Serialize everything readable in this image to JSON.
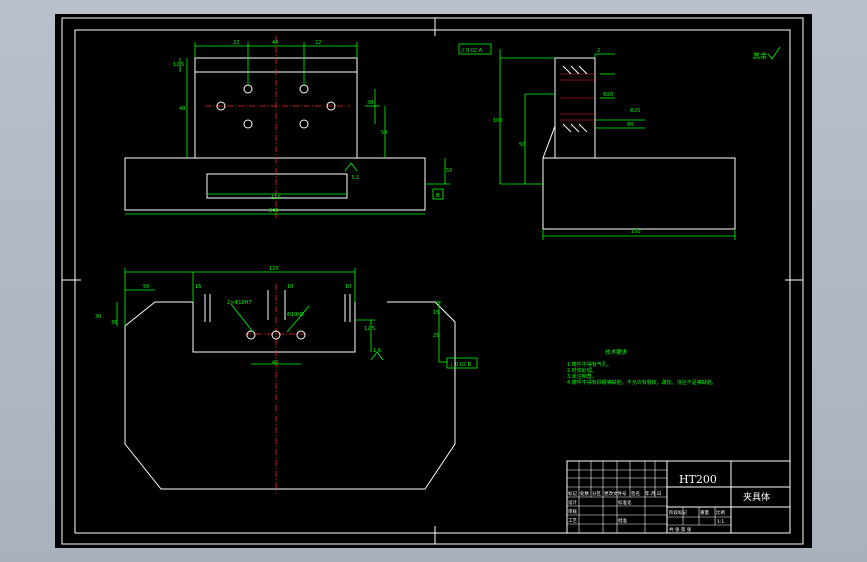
{
  "drawing": {
    "material": "HT200",
    "part_name": "夹具体",
    "roughness_note": "其余",
    "tech_requirements_title": "技术要求",
    "tech_requirements": [
      "1.铸件不得有气孔。",
      "2.时效处理。",
      "3.未注倒角。",
      "4.铸件不得有砂眼等缺陷，不允许有裂纹，疏松，浇注不足等缺陷。"
    ],
    "title_block": {
      "row_labels": [
        "标记",
        "处数",
        "分区",
        "更改文件号",
        "签名",
        "年.月.日"
      ],
      "design": "设计",
      "standardize": "标准化",
      "review": "审核",
      "process": "工艺",
      "approve": "批准",
      "stage_mark": "阶段标记",
      "weight": "重量",
      "scale": "比例",
      "scale_value": "1:1",
      "sheet": "共 张 第 张"
    },
    "top_view": {
      "dim_top_left": "22",
      "dim_top_mid": "44",
      "dim_top_right": "22",
      "dim_left_small": "12.5",
      "dim_left_height": "48",
      "dim_right_a": "38",
      "dim_right_b": "50",
      "dim_inner": "110",
      "dim_overall": "240",
      "dim_height": "50",
      "datum": "B",
      "roughness_1": "3.2"
    },
    "side_view": {
      "fcf": "// 0.02 A",
      "dim_top": "2",
      "dim_a": "Φ20",
      "dim_b": "Φ20",
      "dim_c": "Φ5",
      "dim_height": "100",
      "dim_mid": "50",
      "dim_width": "150"
    },
    "front_view": {
      "dim_left": "30",
      "dim_gap": "50",
      "dim_slot": "120",
      "dim_s1": "16",
      "dim_s2": "10",
      "dim_s3": "10",
      "dim_h1": "30",
      "dim_h2": "15",
      "dim_h3": "25",
      "dim_h4": "12.5",
      "dim_bottom": "40",
      "hole_note_1": "2×Φ10H7",
      "hole_note_2": "Φ10H7",
      "fcf": "⊥ 0.02 B",
      "roughness": "1.6"
    }
  }
}
